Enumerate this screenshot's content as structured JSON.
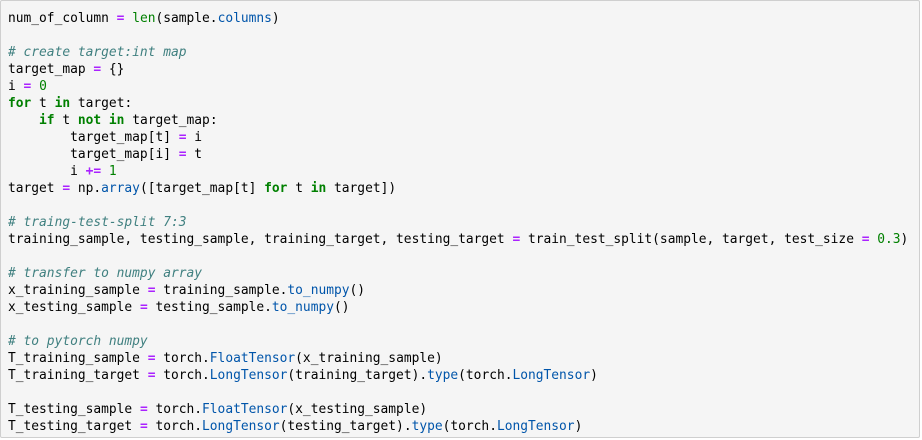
{
  "lines": [
    [
      {
        "t": "num_of_column "
      },
      {
        "t": "=",
        "c": "op"
      },
      {
        "t": " "
      },
      {
        "t": "len",
        "c": "builtin"
      },
      {
        "t": "(sample."
      },
      {
        "t": "columns",
        "c": "attr"
      },
      {
        "t": ")"
      }
    ],
    [],
    [
      {
        "t": "# create target:int map",
        "c": "comment"
      }
    ],
    [
      {
        "t": "target_map "
      },
      {
        "t": "=",
        "c": "op"
      },
      {
        "t": " {}"
      }
    ],
    [
      {
        "t": "i "
      },
      {
        "t": "=",
        "c": "op"
      },
      {
        "t": " "
      },
      {
        "t": "0",
        "c": "num"
      }
    ],
    [
      {
        "t": "for",
        "c": "kw"
      },
      {
        "t": " t "
      },
      {
        "t": "in",
        "c": "kw"
      },
      {
        "t": " target:"
      }
    ],
    [
      {
        "t": "    "
      },
      {
        "t": "if",
        "c": "kw"
      },
      {
        "t": " t "
      },
      {
        "t": "not in",
        "c": "kw"
      },
      {
        "t": " target_map:"
      }
    ],
    [
      {
        "t": "        target_map[t] "
      },
      {
        "t": "=",
        "c": "op"
      },
      {
        "t": " i"
      }
    ],
    [
      {
        "t": "        target_map[i] "
      },
      {
        "t": "=",
        "c": "op"
      },
      {
        "t": " t"
      }
    ],
    [
      {
        "t": "        i "
      },
      {
        "t": "+=",
        "c": "op"
      },
      {
        "t": " "
      },
      {
        "t": "1",
        "c": "num"
      }
    ],
    [
      {
        "t": "target "
      },
      {
        "t": "=",
        "c": "op"
      },
      {
        "t": " np."
      },
      {
        "t": "array",
        "c": "attr"
      },
      {
        "t": "([target_map[t] "
      },
      {
        "t": "for",
        "c": "kw"
      },
      {
        "t": " t "
      },
      {
        "t": "in",
        "c": "kw"
      },
      {
        "t": " target])"
      }
    ],
    [],
    [
      {
        "t": "# traing-test-split 7:3",
        "c": "comment"
      }
    ],
    [
      {
        "t": "training_sample, testing_sample, training_target, testing_target "
      },
      {
        "t": "=",
        "c": "op"
      },
      {
        "t": " train_test_split(sample, target, test_size "
      },
      {
        "t": "=",
        "c": "op"
      },
      {
        "t": " "
      },
      {
        "t": "0.3",
        "c": "num"
      },
      {
        "t": ")"
      }
    ],
    [],
    [
      {
        "t": "# transfer to numpy array",
        "c": "comment"
      }
    ],
    [
      {
        "t": "x_training_sample "
      },
      {
        "t": "=",
        "c": "op"
      },
      {
        "t": " training_sample."
      },
      {
        "t": "to_numpy",
        "c": "attr"
      },
      {
        "t": "()"
      }
    ],
    [
      {
        "t": "x_testing_sample "
      },
      {
        "t": "=",
        "c": "op"
      },
      {
        "t": " testing_sample."
      },
      {
        "t": "to_numpy",
        "c": "attr"
      },
      {
        "t": "()"
      }
    ],
    [],
    [
      {
        "t": "# to pytorch numpy",
        "c": "comment"
      }
    ],
    [
      {
        "t": "T_training_sample "
      },
      {
        "t": "=",
        "c": "op"
      },
      {
        "t": " torch."
      },
      {
        "t": "FloatTensor",
        "c": "attr"
      },
      {
        "t": "(x_training_sample)"
      }
    ],
    [
      {
        "t": "T_training_target "
      },
      {
        "t": "=",
        "c": "op"
      },
      {
        "t": " torch."
      },
      {
        "t": "LongTensor",
        "c": "attr"
      },
      {
        "t": "(training_target)."
      },
      {
        "t": "type",
        "c": "attr"
      },
      {
        "t": "(torch."
      },
      {
        "t": "LongTensor",
        "c": "attr"
      },
      {
        "t": ")"
      }
    ],
    [],
    [
      {
        "t": "T_testing_sample "
      },
      {
        "t": "=",
        "c": "op"
      },
      {
        "t": " torch."
      },
      {
        "t": "FloatTensor",
        "c": "attr"
      },
      {
        "t": "(x_testing_sample)"
      }
    ],
    [
      {
        "t": "T_testing_target "
      },
      {
        "t": "=",
        "c": "op"
      },
      {
        "t": " torch."
      },
      {
        "t": "LongTensor",
        "c": "attr"
      },
      {
        "t": "(testing_target)."
      },
      {
        "t": "type",
        "c": "attr"
      },
      {
        "t": "(torch."
      },
      {
        "t": "LongTensor",
        "c": "attr"
      },
      {
        "t": ")"
      }
    ]
  ]
}
